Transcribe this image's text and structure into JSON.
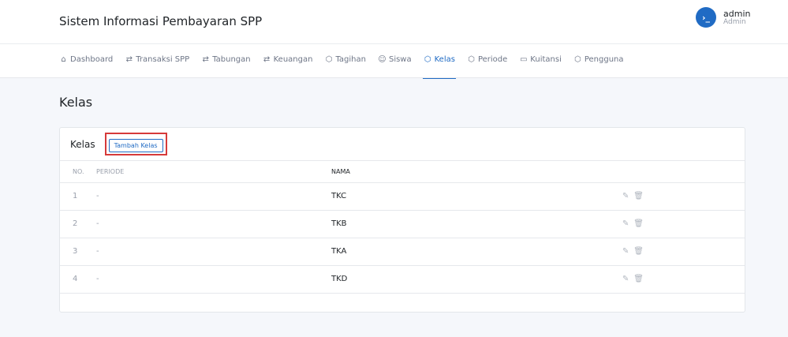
{
  "app": {
    "title": "Sistem Informasi Pembayaran SPP"
  },
  "user": {
    "name": "admin",
    "role": "Admin",
    "avatar_glyph": "›_"
  },
  "nav": {
    "items": [
      {
        "label": "Dashboard",
        "icon": "home-icon",
        "active": false
      },
      {
        "label": "Transaksi SPP",
        "icon": "transfer-icon",
        "active": false
      },
      {
        "label": "Tabungan",
        "icon": "transfer-icon",
        "active": false
      },
      {
        "label": "Keuangan",
        "icon": "transfer-icon",
        "active": false
      },
      {
        "label": "Tagihan",
        "icon": "box-icon",
        "active": false
      },
      {
        "label": "Siswa",
        "icon": "users-icon",
        "active": false
      },
      {
        "label": "Kelas",
        "icon": "box-icon",
        "active": true
      },
      {
        "label": "Periode",
        "icon": "box-icon",
        "active": false
      },
      {
        "label": "Kuitansi",
        "icon": "folder-icon",
        "active": false
      },
      {
        "label": "Pengguna",
        "icon": "box-icon",
        "active": false
      }
    ]
  },
  "page": {
    "title": "Kelas"
  },
  "card": {
    "title": "Kelas",
    "add_button": "Tambah Kelas",
    "columns": {
      "no": "NO.",
      "periode": "PERIODE",
      "nama": "NAMA"
    },
    "rows": [
      {
        "no": "1",
        "periode": "-",
        "nama": "TKC"
      },
      {
        "no": "2",
        "periode": "-",
        "nama": "TKB"
      },
      {
        "no": "3",
        "periode": "-",
        "nama": "TKA"
      },
      {
        "no": "4",
        "periode": "-",
        "nama": "TKD"
      }
    ]
  },
  "colors": {
    "accent": "#206bc4",
    "highlight": "#d63a3a",
    "muted": "#9aa0ac"
  }
}
